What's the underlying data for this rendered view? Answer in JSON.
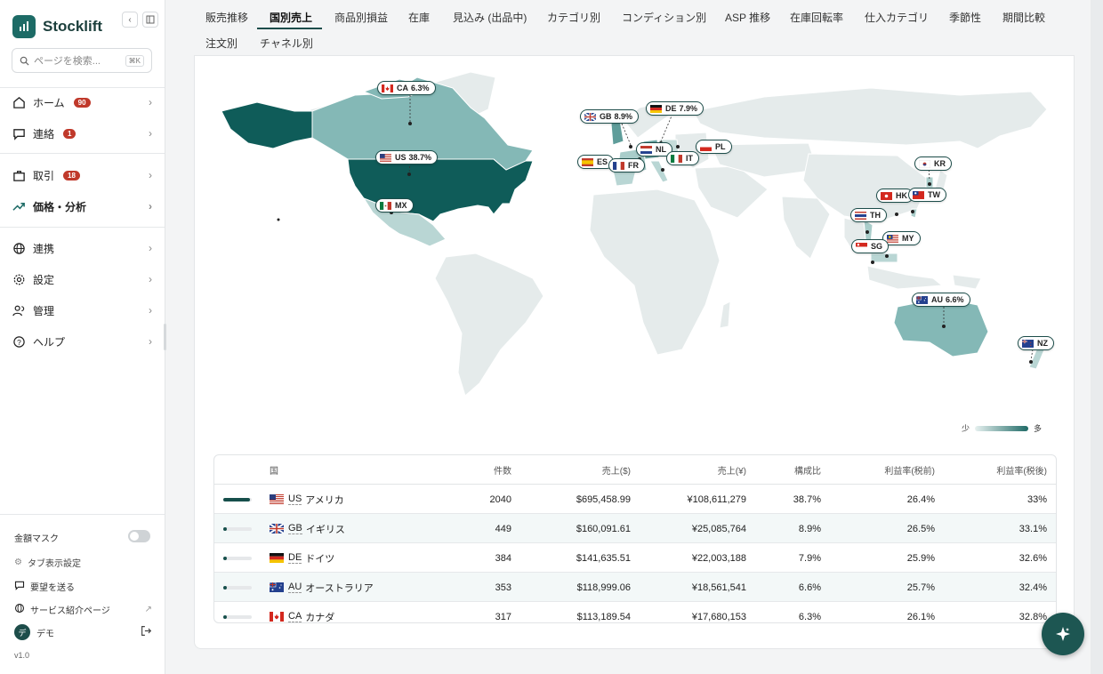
{
  "app": {
    "name": "Stocklift",
    "version": "v1.0"
  },
  "search": {
    "placeholder": "ページを検索...",
    "shortcut": "⌘K"
  },
  "nav": [
    {
      "label": "ホーム",
      "badge": "90"
    },
    {
      "label": "連絡",
      "badge": "1"
    },
    {
      "label": "取引",
      "badge": "18"
    },
    {
      "label": "価格・分析",
      "badge": ""
    },
    {
      "label": "連携",
      "badge": ""
    },
    {
      "label": "設定",
      "badge": ""
    },
    {
      "label": "管理",
      "badge": ""
    },
    {
      "label": "ヘルプ",
      "badge": ""
    }
  ],
  "footer": {
    "mask_label": "金額マスク",
    "tab_settings": "タブ表示設定",
    "feedback": "要望を送る",
    "service_page": "サービス紹介ページ",
    "user_initial": "デ",
    "user_name": "デモ"
  },
  "tabs": [
    "販売推移",
    "国別売上",
    "商品別損益",
    "在庫",
    "見込み (出品中)",
    "カテゴリ別",
    "コンディション別",
    "ASP 推移",
    "在庫回転率",
    "仕入カテゴリ",
    "季節性",
    "期間比較",
    "注文別",
    "チャネル別"
  ],
  "active_tab": "国別売上",
  "map_labels": [
    {
      "code": "CA",
      "pct": "6.3%"
    },
    {
      "code": "US",
      "pct": "38.7%"
    },
    {
      "code": "MX",
      "pct": ""
    },
    {
      "code": "GB",
      "pct": "8.9%"
    },
    {
      "code": "DE",
      "pct": "7.9%"
    },
    {
      "code": "NL",
      "pct": ""
    },
    {
      "code": "PL",
      "pct": ""
    },
    {
      "code": "ES",
      "pct": ""
    },
    {
      "code": "FR",
      "pct": ""
    },
    {
      "code": "IT",
      "pct": ""
    },
    {
      "code": "KR",
      "pct": ""
    },
    {
      "code": "HK",
      "pct": ""
    },
    {
      "code": "TW",
      "pct": ""
    },
    {
      "code": "TH",
      "pct": ""
    },
    {
      "code": "MY",
      "pct": ""
    },
    {
      "code": "SG",
      "pct": ""
    },
    {
      "code": "AU",
      "pct": "6.6%"
    },
    {
      "code": "NZ",
      "pct": ""
    }
  ],
  "legend": {
    "low": "少",
    "high": "多"
  },
  "table": {
    "headers": [
      "国",
      "件数",
      "売上($)",
      "売上(¥)",
      "構成比",
      "利益率(税前)",
      "利益率(税後)"
    ],
    "rows": [
      {
        "code": "US",
        "name": "アメリカ",
        "count": "2040",
        "usd": "$695,458.99",
        "jpy": "¥108,611,279",
        "share": "38.7%",
        "pre": "26.4%",
        "post": "33%",
        "bar": 0.387
      },
      {
        "code": "GB",
        "name": "イギリス",
        "count": "449",
        "usd": "$160,091.61",
        "jpy": "¥25,085,764",
        "share": "8.9%",
        "pre": "26.5%",
        "post": "33.1%",
        "bar": 0.089
      },
      {
        "code": "DE",
        "name": "ドイツ",
        "count": "384",
        "usd": "$141,635.51",
        "jpy": "¥22,003,188",
        "share": "7.9%",
        "pre": "25.9%",
        "post": "32.6%",
        "bar": 0.079
      },
      {
        "code": "AU",
        "name": "オーストラリア",
        "count": "353",
        "usd": "$118,999.06",
        "jpy": "¥18,561,541",
        "share": "6.6%",
        "pre": "25.7%",
        "post": "32.4%",
        "bar": 0.066
      },
      {
        "code": "CA",
        "name": "カナダ",
        "count": "317",
        "usd": "$113,189.54",
        "jpy": "¥17,680,153",
        "share": "6.3%",
        "pre": "26.1%",
        "post": "32.8%",
        "bar": 0.063
      }
    ]
  },
  "colors": {
    "accent": "#1d6b66",
    "dark": "#0f5c59",
    "mid": "#84b8b6",
    "light": "#b9d6d4",
    "land": "#e5ebeb"
  }
}
